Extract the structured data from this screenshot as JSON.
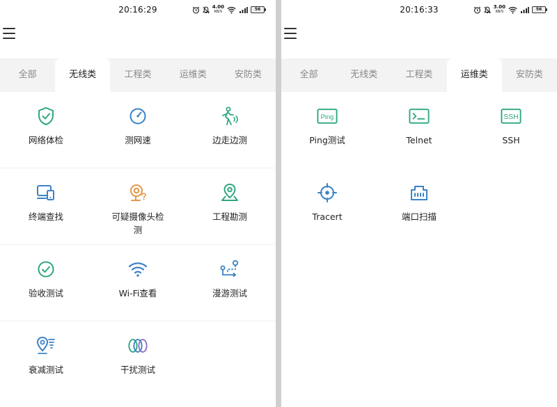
{
  "left": {
    "status": {
      "time": "20:16:29",
      "speed_value": "4.00",
      "speed_unit": "KB/S",
      "battery": "56"
    },
    "tabs": [
      {
        "label": "全部",
        "active": false
      },
      {
        "label": "无线类",
        "active": true
      },
      {
        "label": "工程类",
        "active": false
      },
      {
        "label": "运维类",
        "active": false
      },
      {
        "label": "安防类",
        "active": false
      }
    ],
    "tools": [
      {
        "label": "网络体检",
        "icon": "shield-check-icon"
      },
      {
        "label": "测网速",
        "icon": "speed-gauge-icon"
      },
      {
        "label": "边走边测",
        "icon": "walking-person-icon"
      },
      {
        "label": "终端查找",
        "icon": "device-search-icon"
      },
      {
        "label": "可疑摄像头检测",
        "icon": "camera-detect-icon"
      },
      {
        "label": "工程勘测",
        "icon": "map-pin-icon"
      },
      {
        "label": "验收测试",
        "icon": "check-circle-icon"
      },
      {
        "label": "Wi-Fi查看",
        "icon": "wifi-icon"
      },
      {
        "label": "漫游测试",
        "icon": "roaming-path-icon"
      },
      {
        "label": "衰减测试",
        "icon": "attenuation-icon"
      },
      {
        "label": "干扰测试",
        "icon": "interference-rings-icon"
      }
    ]
  },
  "right": {
    "status": {
      "time": "20:16:33",
      "speed_value": "3.00",
      "speed_unit": "KB/S",
      "battery": "56"
    },
    "tabs": [
      {
        "label": "全部",
        "active": false
      },
      {
        "label": "无线类",
        "active": false
      },
      {
        "label": "工程类",
        "active": false
      },
      {
        "label": "运维类",
        "active": true
      },
      {
        "label": "安防类",
        "active": false
      }
    ],
    "tools": [
      {
        "label": "Ping测试",
        "icon": "ping-icon",
        "icon_text": "Ping"
      },
      {
        "label": "Telnet",
        "icon": "terminal-icon"
      },
      {
        "label": "SSH",
        "icon": "ssh-icon",
        "icon_text": "SSH"
      },
      {
        "label": "Tracert",
        "icon": "crosshair-icon"
      },
      {
        "label": "端口扫描",
        "icon": "ethernet-port-icon"
      }
    ]
  },
  "colors": {
    "accent_green": "#2da77f",
    "accent_blue": "#3b82c4",
    "accent_orange": "#e2984a",
    "accent_purple": "#8a6fc8"
  }
}
